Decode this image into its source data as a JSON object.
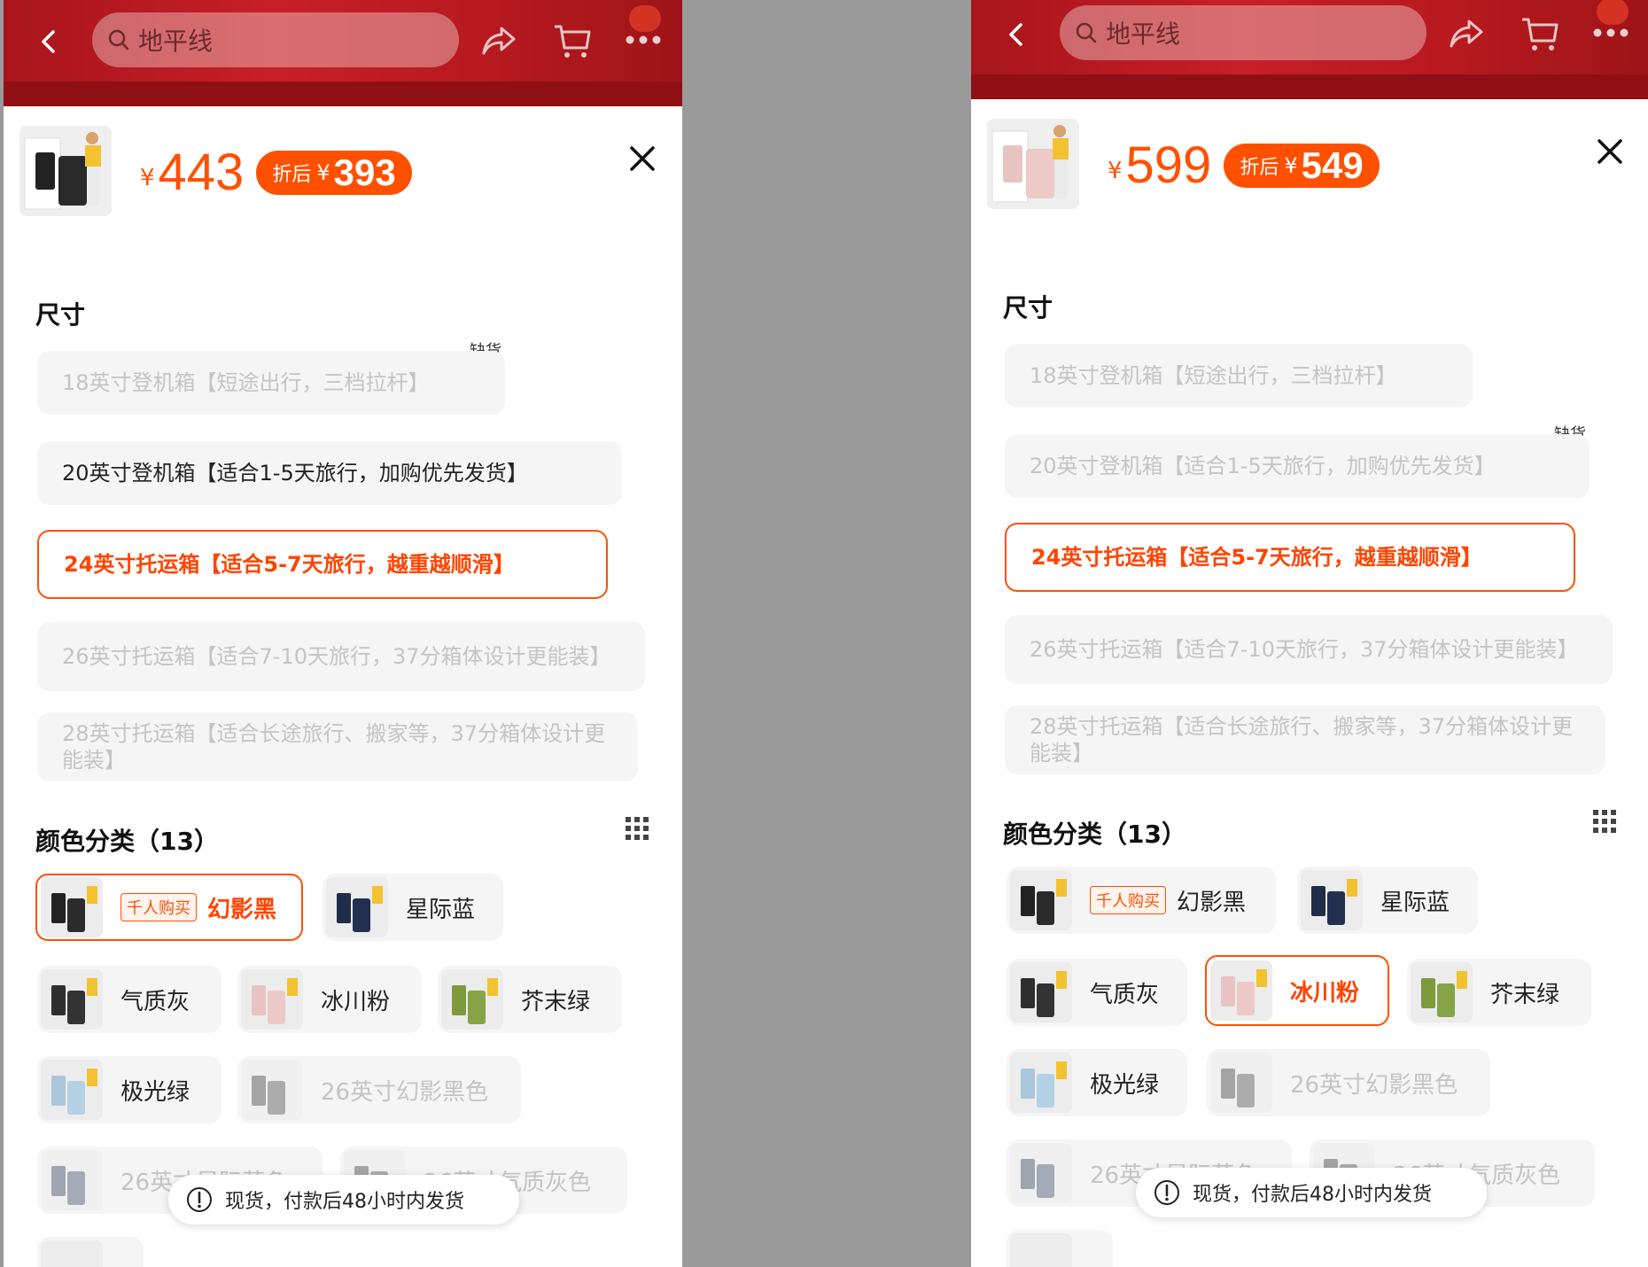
{
  "colors": {
    "accent": "#ff5000",
    "header_red": "#c71f25"
  },
  "panels": [
    {
      "search_text": "地平线",
      "price_yen": "¥",
      "price": "443",
      "discount_label": "折后",
      "discount_yen": "¥",
      "discount_price": "393",
      "size_title": "尺寸",
      "sizes": [
        {
          "label": "18英寸登机箱【短途出行，三档拉杆】",
          "state": "disabled"
        },
        {
          "label": "20英寸登机箱【适合1-5天旅行，加购优先发货】",
          "state": "normal"
        },
        {
          "label": "24英寸托运箱【适合5-7天旅行，越重越顺滑】",
          "state": "selected"
        },
        {
          "label": "26英寸托运箱【适合7-10天旅行，37分箱体设计更能装】",
          "state": "disabled"
        },
        {
          "label": "28英寸托运箱【适合长途旅行、搬家等，37分箱体设计更能装】",
          "state": "disabled"
        }
      ],
      "out_of_stock_label": "缺货",
      "color_title": "颜色分类（13）",
      "color_items": [
        {
          "label": "幻影黑",
          "hot_tag": "千人购买",
          "state": "selected"
        },
        {
          "label": "星际蓝",
          "state": "normal"
        },
        {
          "label": "气质灰",
          "state": "normal"
        },
        {
          "label": "冰川粉",
          "state": "normal"
        },
        {
          "label": "芥末绿",
          "state": "normal"
        },
        {
          "label": "极光绿",
          "state": "normal"
        },
        {
          "label": "26英寸幻影黑色",
          "state": "disabled"
        },
        {
          "label": "26英寸星际蓝色",
          "state": "disabled"
        },
        {
          "label": "26英寸气质灰色",
          "state": "disabled"
        }
      ],
      "toast_text": "现货，付款后48小时内发货"
    },
    {
      "search_text": "地平线",
      "price_yen": "¥",
      "price": "599",
      "discount_label": "折后",
      "discount_yen": "¥",
      "discount_price": "549",
      "size_title": "尺寸",
      "sizes": [
        {
          "label": "18英寸登机箱【短途出行，三档拉杆】",
          "state": "disabled"
        },
        {
          "label": "20英寸登机箱【适合1-5天旅行，加购优先发货】",
          "state": "disabled"
        },
        {
          "label": "24英寸托运箱【适合5-7天旅行，越重越顺滑】",
          "state": "selected"
        },
        {
          "label": "26英寸托运箱【适合7-10天旅行，37分箱体设计更能装】",
          "state": "disabled"
        },
        {
          "label": "28英寸托运箱【适合长途旅行、搬家等，37分箱体设计更能装】",
          "state": "disabled"
        }
      ],
      "out_of_stock_label": "缺货",
      "color_title": "颜色分类（13）",
      "color_items": [
        {
          "label": "幻影黑",
          "hot_tag": "千人购买",
          "state": "normal"
        },
        {
          "label": "星际蓝",
          "state": "normal"
        },
        {
          "label": "气质灰",
          "state": "normal"
        },
        {
          "label": "冰川粉",
          "state": "selected"
        },
        {
          "label": "芥末绿",
          "state": "normal"
        },
        {
          "label": "极光绿",
          "state": "normal"
        },
        {
          "label": "26英寸幻影黑色",
          "state": "disabled"
        },
        {
          "label": "26英寸星际蓝色",
          "state": "disabled"
        },
        {
          "label": "26英寸气质灰色",
          "state": "disabled"
        }
      ],
      "toast_text": "现货，付款后48小时内发货"
    }
  ]
}
